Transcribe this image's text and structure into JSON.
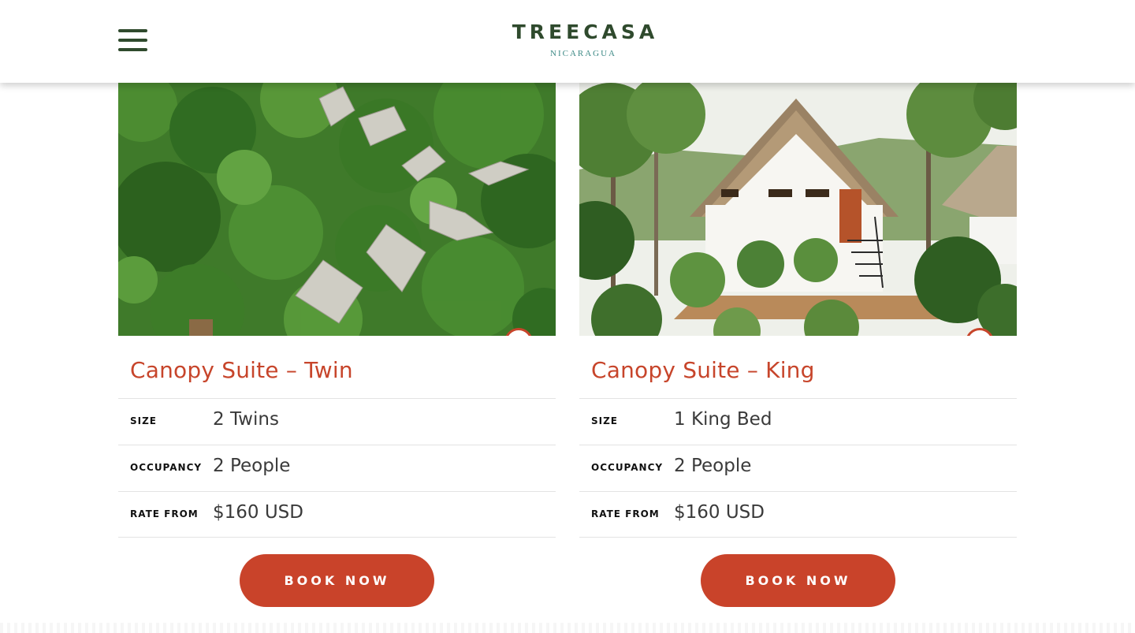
{
  "header": {
    "logo_main": "TREECASA",
    "logo_sub": "NICARAGUA",
    "menu_icon": "hamburger-icon"
  },
  "colors": {
    "brand_green": "#2f4a2d",
    "accent_red": "#c7452b",
    "teal": "#3e8a86"
  },
  "cards": [
    {
      "title": "Canopy Suite – Twin",
      "specs": [
        {
          "label": "SIZE",
          "value": "2 Twins"
        },
        {
          "label": "OCCUPANCY",
          "value": "2 People"
        },
        {
          "label": "RATE FROM",
          "value": "$160 USD"
        }
      ],
      "button": "BOOK NOW",
      "arrow_icon": "chevron-right-icon"
    },
    {
      "title": "Canopy Suite – King",
      "specs": [
        {
          "label": "SIZE",
          "value": "1 King Bed"
        },
        {
          "label": "OCCUPANCY",
          "value": "2 People"
        },
        {
          "label": "RATE FROM",
          "value": "$160 USD"
        }
      ],
      "button": "BOOK NOW",
      "arrow_icon": "chevron-right-icon"
    }
  ]
}
